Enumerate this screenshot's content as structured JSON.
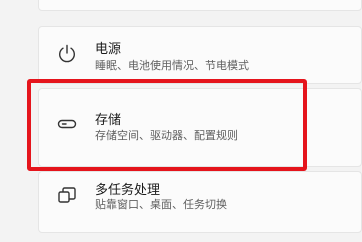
{
  "items": [
    {
      "title": "电源",
      "subtitle": "睡眠、电池使用情况、节电模式",
      "icon": "power-icon"
    },
    {
      "title": "存储",
      "subtitle": "存储空间、驱动器、配置规则",
      "icon": "storage-drive-icon"
    },
    {
      "title": "多任务处理",
      "subtitle": "贴靠窗口、桌面、任务切换",
      "icon": "multitasking-icon"
    }
  ],
  "highlight_color": "#e5141c"
}
